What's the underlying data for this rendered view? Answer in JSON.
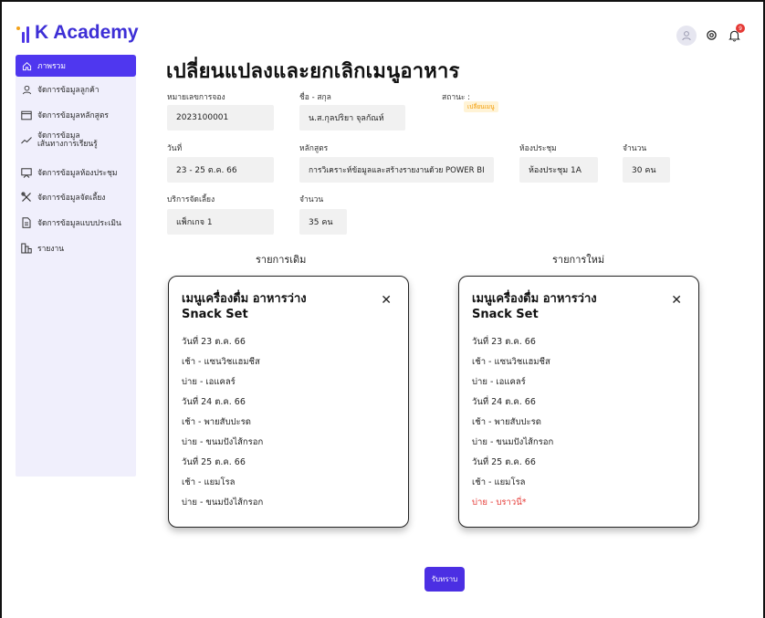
{
  "brand": {
    "name": "K Academy"
  },
  "sidebar": {
    "items": [
      {
        "label": "ภาพรวม",
        "icon": "home-icon",
        "active": true
      },
      {
        "label": "จัดการข้อมูลลูกค้า",
        "icon": "user-icon"
      },
      {
        "label": "จัดการข้อมูลหลักสูตร",
        "icon": "folder-icon"
      },
      {
        "label1": "จัดการข้อมูล",
        "label2": "เส้นทางการเรียนรู้",
        "icon": "trend-icon"
      },
      {
        "label": "จัดการข้อมูลห้องประชุม",
        "icon": "presentation-icon"
      },
      {
        "label": "จัดการข้อมูลจัดเลี้ยง",
        "icon": "utensils-icon"
      },
      {
        "label": "จัดการข้อมูลแบบประเมิน",
        "icon": "document-icon"
      },
      {
        "label": "รายงาน",
        "icon": "report-icon"
      }
    ]
  },
  "header": {
    "notification_count": "9"
  },
  "page": {
    "title": "เปลี่ยนแปลงและยกเลิกเมนูอาหาร"
  },
  "form": {
    "booking_no_label": "หมายเลขการจอง",
    "booking_no": "2023100001",
    "name_label": "ชื่อ - สกุล",
    "name": "น.ส.กุลปริยา จุลกัณห์",
    "status_label": "สถานะ :",
    "status": "เปลี่ยนเมนู",
    "date_label": "วันที่",
    "date": "23 - 25 ต.ค. 66",
    "course_label": "หลักสูตร",
    "course": "การวิเคราะห์ข้อมูลและสร้างรายงานด้วย POWER BI",
    "room_label": "ห้องประชุม",
    "room": "ห้องประชุม 1A",
    "count_label": "จำนวน",
    "count": "30 คน",
    "catering_label": "บริการจัดเลี้ยง",
    "catering": "แพ็กเกจ 1",
    "catering_count_label": "จำนวน",
    "catering_count": "35 คน"
  },
  "original": {
    "heading": "รายการเดิม",
    "title1": "เมนูเครื่องดื่ม อาหารว่าง",
    "title2": "Snack Set",
    "rows": [
      "วันที่ 23 ต.ค. 66",
      "เช้า - แซนวิชแฮมชีส",
      "บ่าย - เอแคลร์",
      "วันที่ 24 ต.ค. 66",
      "เช้า - พายสับปะรด",
      "บ่าย - ขนมปังไส้กรอก",
      "วันที่ 25 ต.ค. 66",
      "เช้า - แยมโรล",
      "บ่าย - ขนมปังไส้กรอก"
    ]
  },
  "updated": {
    "heading": "รายการใหม่",
    "title1": "เมนูเครื่องดื่ม อาหารว่าง",
    "title2": "Snack Set",
    "rows": [
      "วันที่ 23 ต.ค. 66",
      "เช้า - แซนวิชแฮมชีส",
      "บ่าย - เอแคลร์",
      "วันที่ 24 ต.ค. 66",
      "เช้า - พายสับปะรด",
      "บ่าย - ขนมปังไส้กรอก",
      "วันที่ 25 ต.ค. 66",
      "เช้า - แยมโรล",
      "บ่าย - บราวนี่*"
    ]
  },
  "actions": {
    "ack_label": "รับทราบ"
  },
  "colors": {
    "accent": "#4f37ef",
    "changed": "#e53935",
    "status_text": "#f29a00"
  }
}
